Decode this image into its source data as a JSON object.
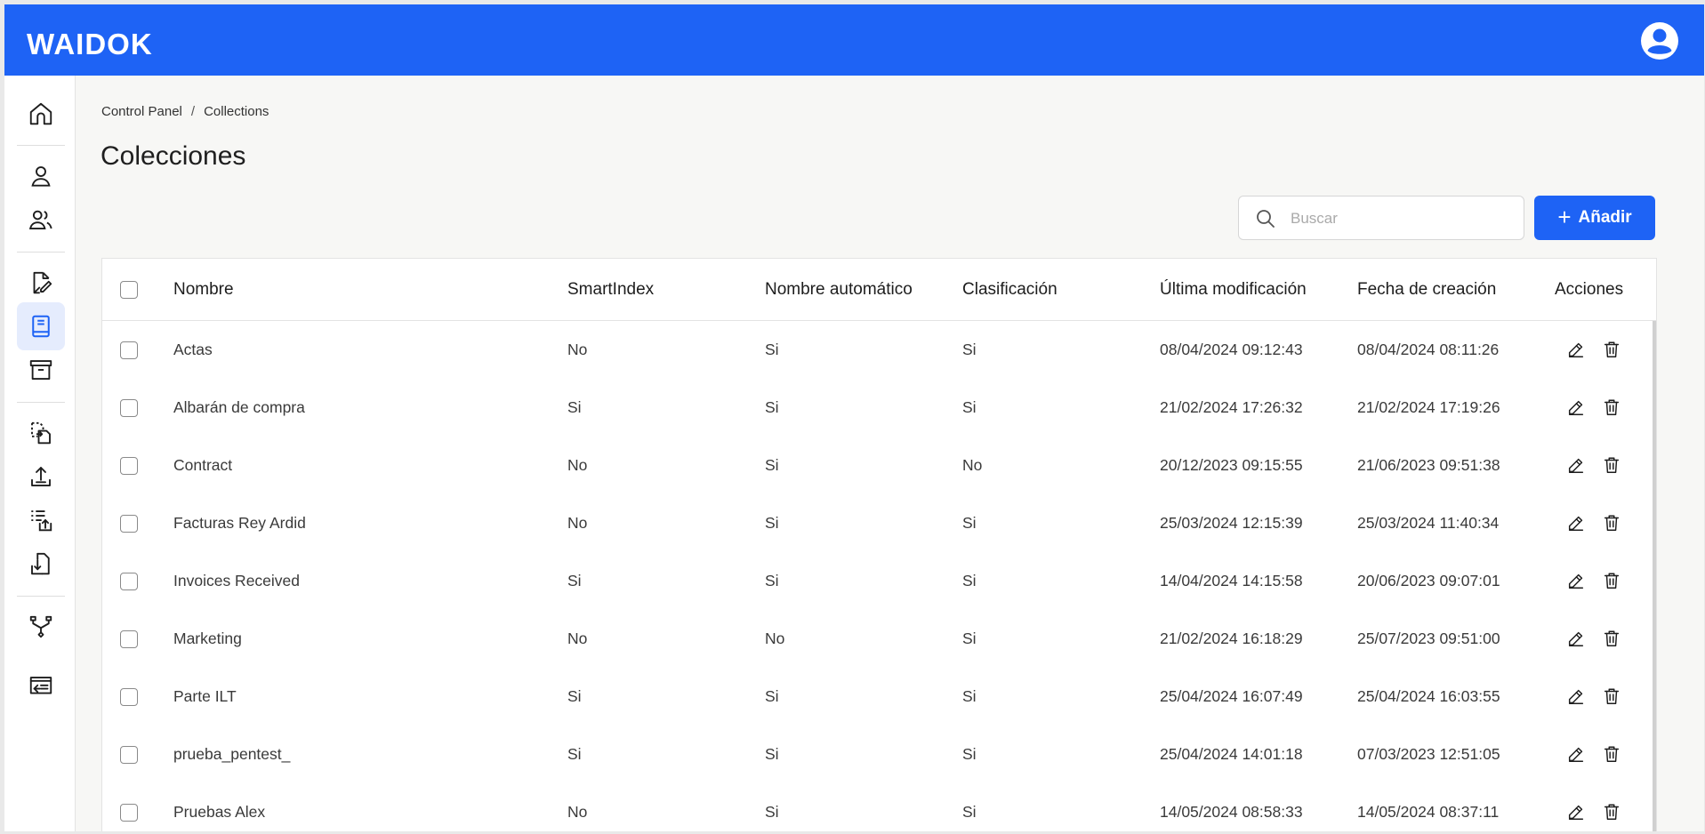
{
  "app": {
    "logo_text": "WAIDOK"
  },
  "colors": {
    "brand": "#1e63f5",
    "active_bg": "#e5ecfd"
  },
  "sidebar": {
    "items": [
      {
        "icon": "home-icon"
      },
      {
        "icon": "user-icon"
      },
      {
        "icon": "users-icon"
      },
      {
        "icon": "document-edit-icon"
      },
      {
        "icon": "collections-book-icon",
        "active": true
      },
      {
        "icon": "archive-icon"
      },
      {
        "icon": "document-transfer-icon"
      },
      {
        "icon": "upload-icon"
      },
      {
        "icon": "list-upload-icon"
      },
      {
        "icon": "document-download-icon"
      },
      {
        "icon": "workflow-icon"
      },
      {
        "icon": "import-screen-icon"
      }
    ]
  },
  "breadcrumb": {
    "items": [
      "Control Panel",
      "Collections"
    ],
    "separator": "/"
  },
  "page": {
    "title": "Colecciones"
  },
  "toolbar": {
    "search_placeholder": "Buscar",
    "add_label": "Añadir",
    "add_plus": "+"
  },
  "table": {
    "columns": [
      "Nombre",
      "SmartIndex",
      "Nombre automático",
      "Clasificación",
      "Última modificación",
      "Fecha de creación",
      "Acciones"
    ],
    "rows": [
      [
        "Actas",
        "No",
        "Si",
        "Si",
        "08/04/2024 09:12:43",
        "08/04/2024 08:11:26"
      ],
      [
        "Albarán de compra",
        "Si",
        "Si",
        "Si",
        "21/02/2024 17:26:32",
        "21/02/2024 17:19:26"
      ],
      [
        "Contract",
        "No",
        "Si",
        "No",
        "20/12/2023 09:15:55",
        "21/06/2023 09:51:38"
      ],
      [
        "Facturas Rey Ardid",
        "No",
        "Si",
        "Si",
        "25/03/2024 12:15:39",
        "25/03/2024 11:40:34"
      ],
      [
        "Invoices Received",
        "Si",
        "Si",
        "Si",
        "14/04/2024 14:15:58",
        "20/06/2023 09:07:01"
      ],
      [
        "Marketing",
        "No",
        "No",
        "Si",
        "21/02/2024 16:18:29",
        "25/07/2023 09:51:00"
      ],
      [
        "Parte ILT",
        "Si",
        "Si",
        "Si",
        "25/04/2024 16:07:49",
        "25/04/2024 16:03:55"
      ],
      [
        "prueba_pentest_",
        "Si",
        "Si",
        "Si",
        "25/04/2024 14:01:18",
        "07/03/2023 12:51:05"
      ],
      [
        "Pruebas Alex",
        "No",
        "Si",
        "Si",
        "14/05/2024 08:58:33",
        "14/05/2024 08:37:11"
      ]
    ]
  }
}
